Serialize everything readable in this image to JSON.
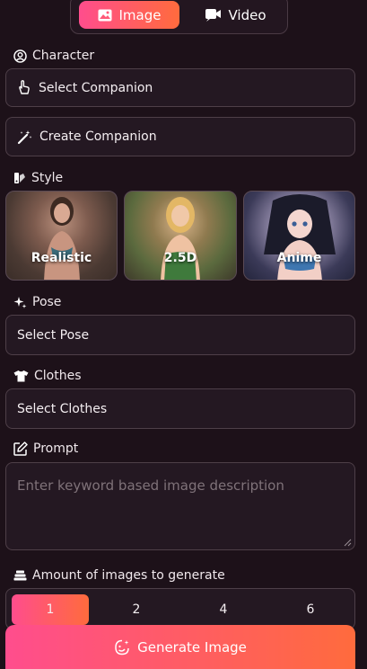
{
  "mode_tabs": {
    "image_label": "Image",
    "video_label": "Video",
    "active": "Image"
  },
  "character": {
    "heading": "Character",
    "select_label": "Select Companion",
    "create_label": "Create Companion"
  },
  "style": {
    "heading": "Style",
    "options": [
      {
        "label": "Realistic",
        "icon": "woman-photo-thumbnail"
      },
      {
        "label": "2.5D",
        "icon": "woman-illustration-thumbnail"
      },
      {
        "label": "Anime",
        "icon": "anime-girl-thumbnail"
      }
    ]
  },
  "pose": {
    "heading": "Pose",
    "select_label": "Select Pose"
  },
  "clothes": {
    "heading": "Clothes",
    "select_label": "Select Clothes"
  },
  "prompt": {
    "heading": "Prompt",
    "placeholder": "Enter keyword based image description",
    "value": ""
  },
  "amount": {
    "heading": "Amount of images to generate",
    "options": [
      "1",
      "2",
      "4",
      "6"
    ],
    "selected": "1"
  },
  "generate": {
    "label": "Generate Image"
  },
  "colors": {
    "background": "#1d1119",
    "accent_start": "#ff4d8d",
    "accent_end": "#ff6b3d",
    "field_bg": "#241822",
    "border": "#4e3f48"
  }
}
